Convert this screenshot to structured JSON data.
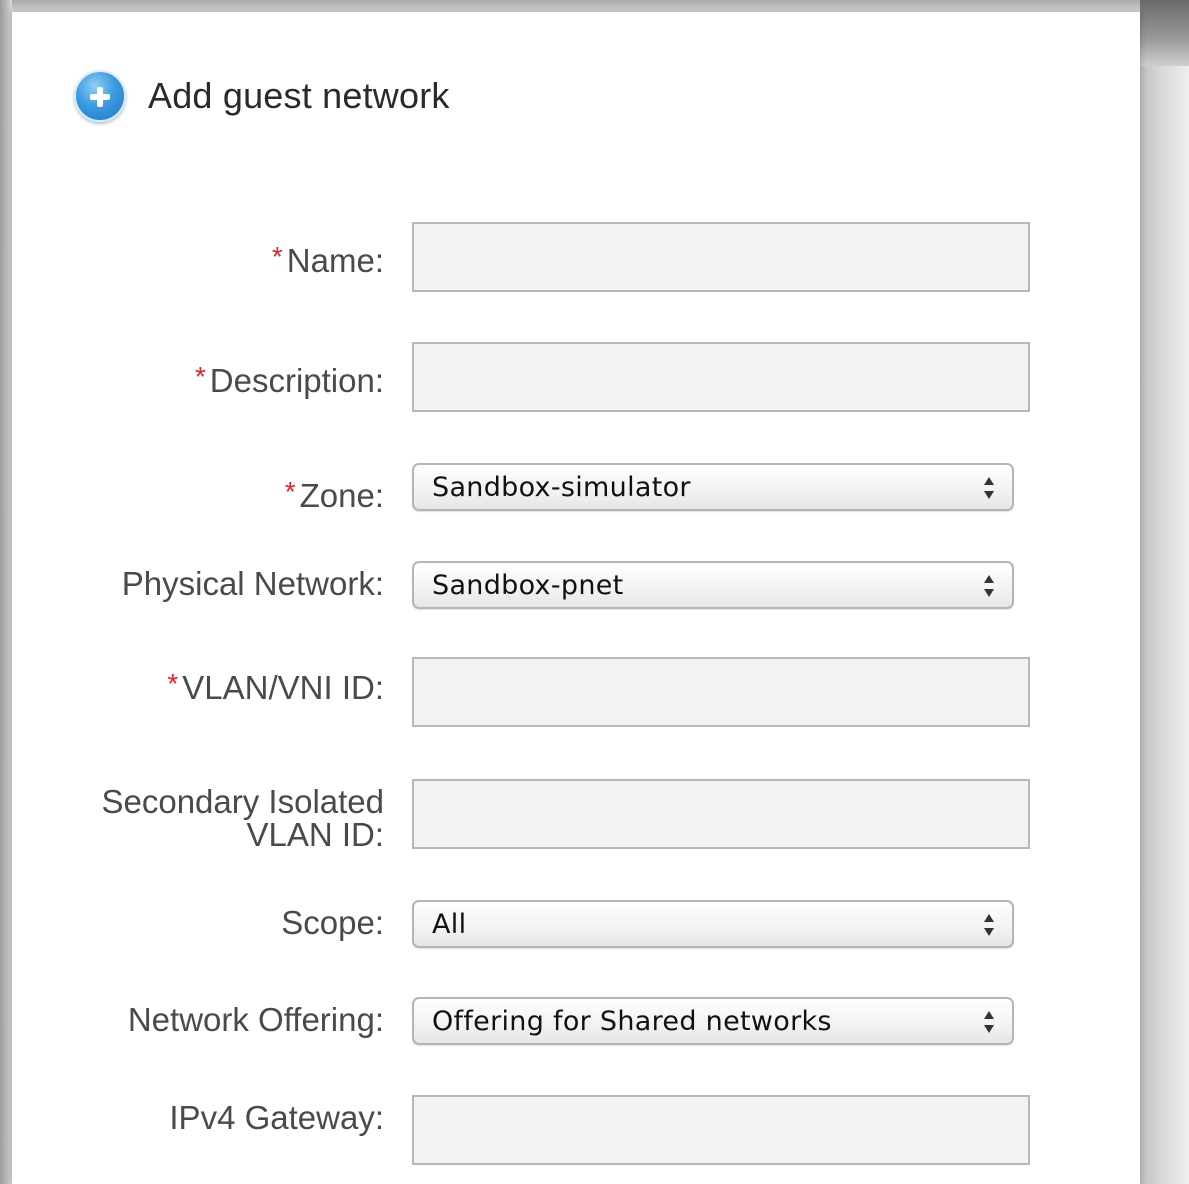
{
  "dialog": {
    "title": "Add guest network",
    "title_icon": "add-circle-icon"
  },
  "fields": {
    "name": {
      "required_marker": "*",
      "label": "Name:",
      "value": ""
    },
    "description": {
      "required_marker": "*",
      "label": "Description:",
      "value": ""
    },
    "zone": {
      "required_marker": "*",
      "label": "Zone:",
      "selected": "Sandbox-simulator"
    },
    "physical_network": {
      "label": "Physical Network:",
      "selected": "Sandbox-pnet"
    },
    "vlan_vni_id": {
      "required_marker": "*",
      "label": "VLAN/VNI ID:",
      "value": ""
    },
    "secondary_isolated_vlan_id": {
      "label_line1": "Secondary Isolated",
      "label_line2": "VLAN ID:",
      "value": ""
    },
    "scope": {
      "label": "Scope:",
      "selected": "All"
    },
    "network_offering": {
      "label": "Network Offering:",
      "selected": "Offering for Shared networks"
    },
    "ipv4_gateway": {
      "label": "IPv4 Gateway:",
      "value": ""
    }
  },
  "colors": {
    "required_marker": "#e0242a",
    "label_text": "#4a4a4a",
    "title_icon": "#2d8ad6"
  }
}
